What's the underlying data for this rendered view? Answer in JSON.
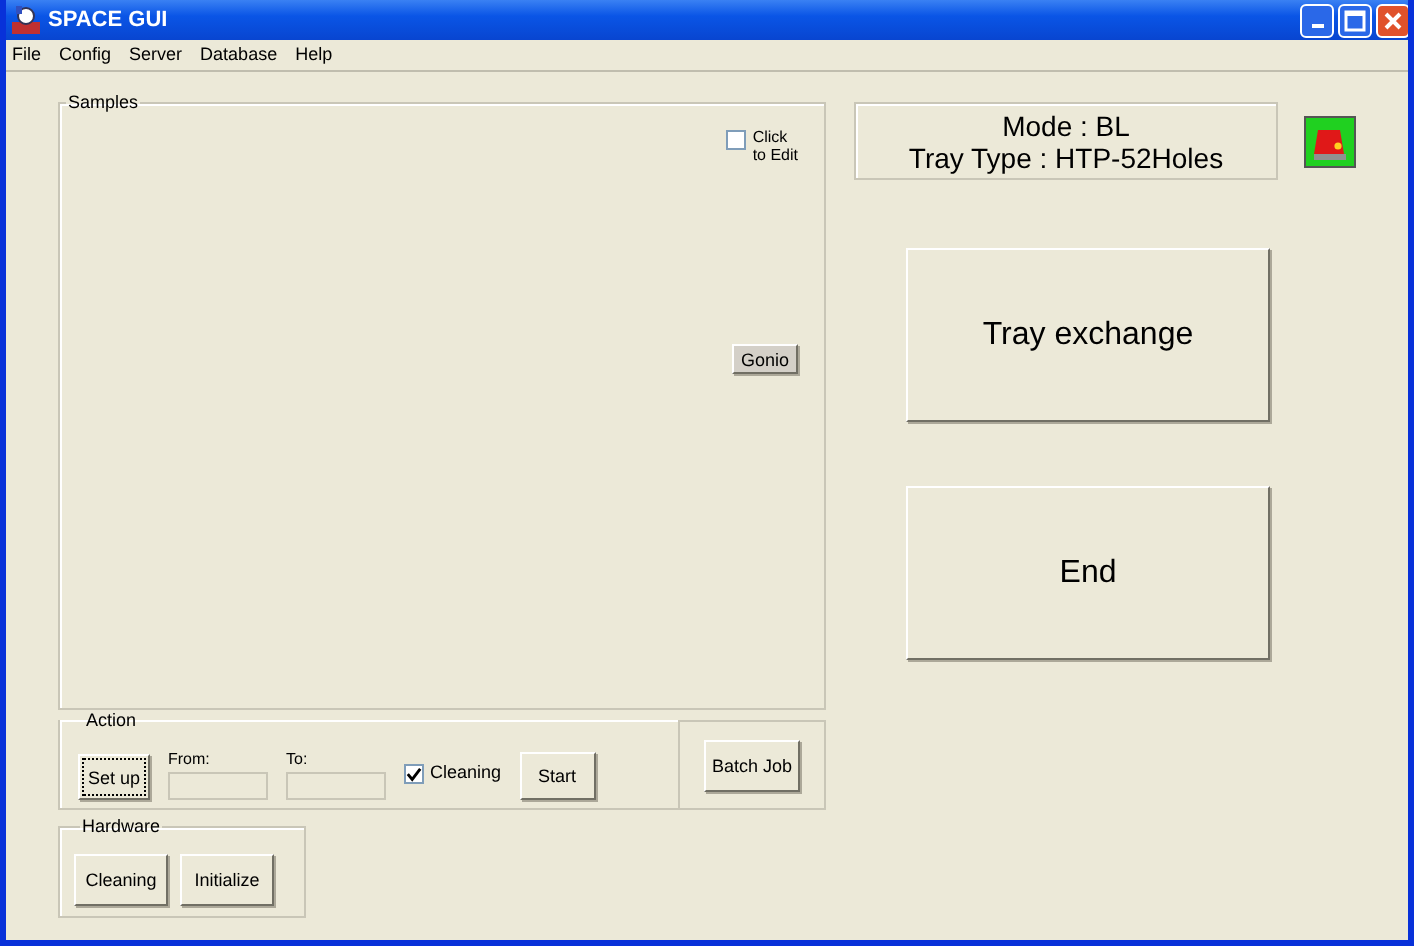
{
  "window": {
    "title": "SPACE GUI"
  },
  "menu": [
    "File",
    "Config",
    "Server",
    "Database",
    "Help"
  ],
  "samples": {
    "title": "Samples",
    "edit_checkbox": {
      "label": "Click\nto Edit",
      "checked": false
    },
    "gonio_button": "Gonio"
  },
  "action": {
    "title": "Action",
    "setup_button": {
      "label": "Set up",
      "focused": true
    },
    "from": {
      "label": "From:"
    },
    "to": {
      "label": "To:"
    },
    "cleaning_checkbox": {
      "label": "Cleaning",
      "checked": true
    },
    "start_button": "Start",
    "batch_button": "Batch Job"
  },
  "hardware": {
    "title": "Hardware",
    "buttons": [
      "Cleaning",
      "Initialize"
    ]
  },
  "status": {
    "mode": "Mode : BL",
    "tray_type": "Tray Type : HTP-52Holes"
  },
  "main_buttons": [
    "Tray exchange",
    "End"
  ]
}
